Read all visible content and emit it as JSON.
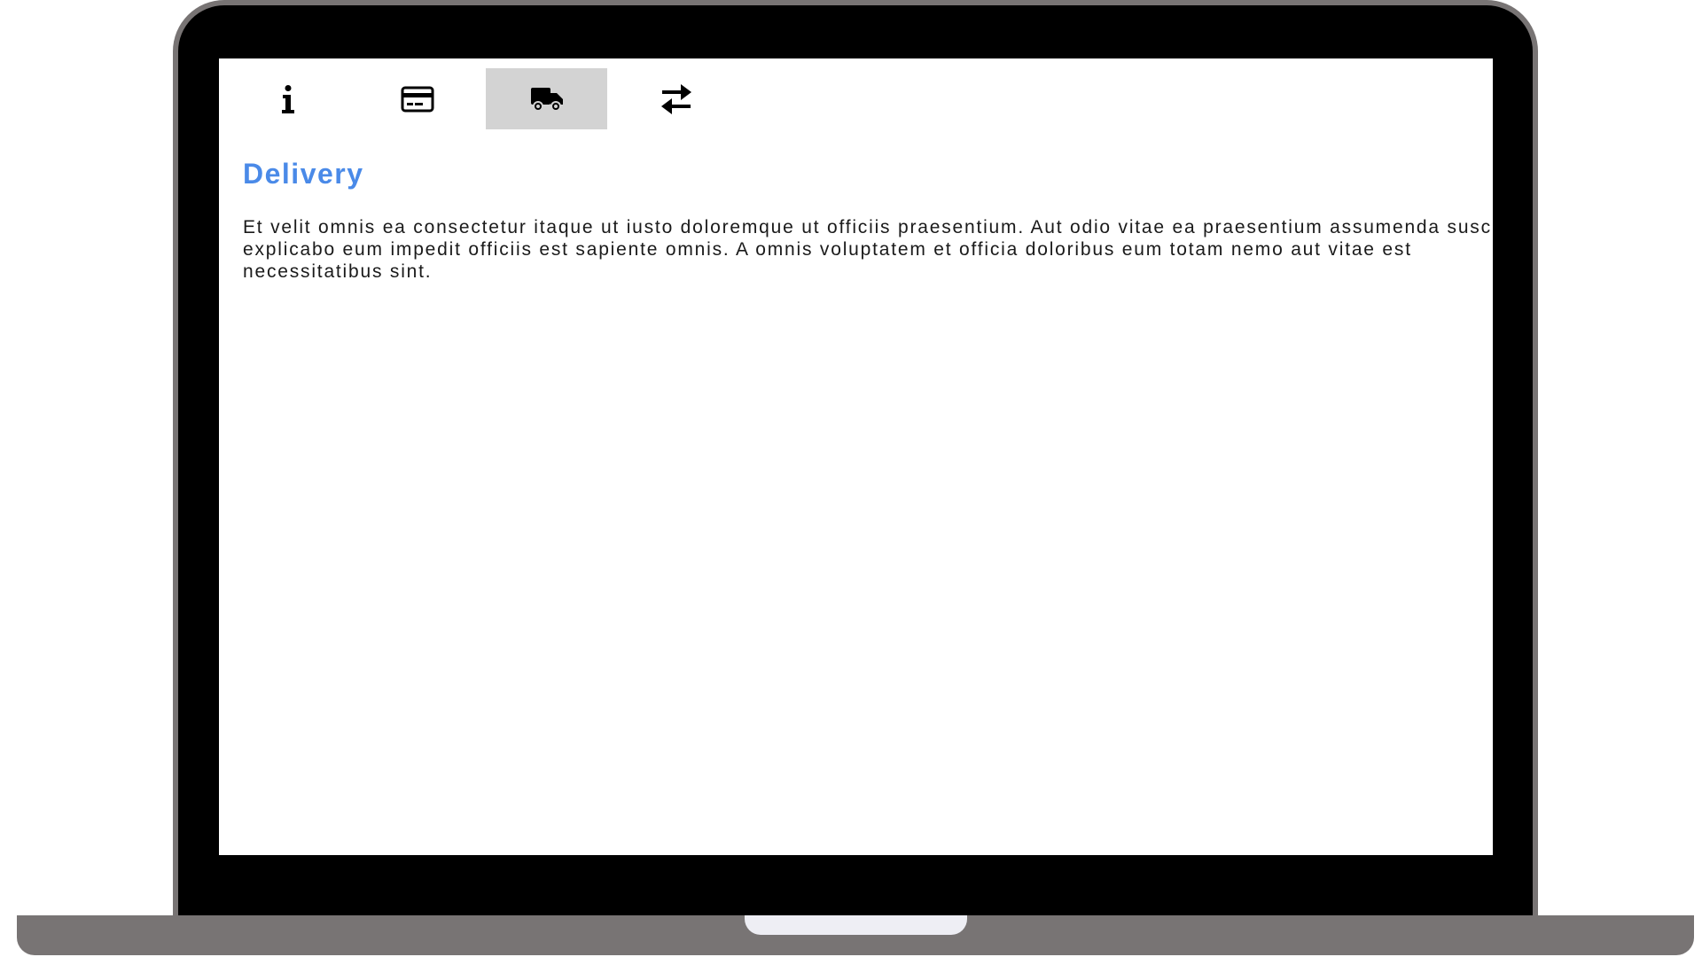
{
  "colors": {
    "accent": "#4a8ae8",
    "active_tab_bg": "#d3d3d3",
    "device_frame": "#787474"
  },
  "tabs": [
    {
      "icon": "info-icon",
      "active": false
    },
    {
      "icon": "credit-card-icon",
      "active": false
    },
    {
      "icon": "truck-icon",
      "active": true
    },
    {
      "icon": "exchange-arrows-icon",
      "active": false
    }
  ],
  "section": {
    "title": "Delivery",
    "body": "Et velit omnis ea consectetur itaque ut iusto doloremque ut officiis praesentium. Aut odio vitae ea praesentium assumenda suscipit explicabo eum impedit officiis est sapiente omnis. A omnis voluptatem et officia doloribus eum totam nemo aut vitae est necessitatibus sint."
  }
}
